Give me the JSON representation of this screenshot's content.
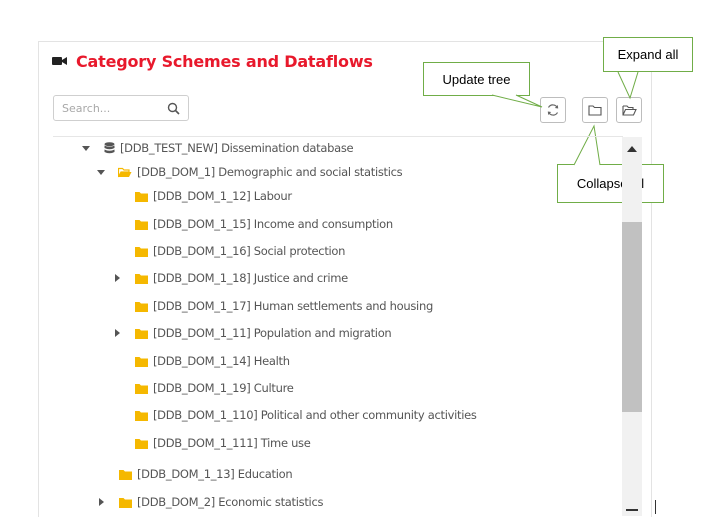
{
  "panel": {
    "title": "Category Schemes and Dataflows",
    "title_color": "#e8192c",
    "title_icon": "video-camera-icon"
  },
  "search": {
    "placeholder": "Search...",
    "icon": "search-icon"
  },
  "toolbar": {
    "update_icon": "refresh-icon",
    "collapse_icon": "folder-icon",
    "expand_icon": "folder-open-icon"
  },
  "callouts": {
    "update_tree": "Update tree",
    "expand_all": "Expand all",
    "collapse_all": "Collapse all",
    "border_color": "#70ad47"
  },
  "tree": [
    {
      "label": "[DDB_TEST_NEW] Dissemination database",
      "icon": "database-icon",
      "expander": "expanded"
    },
    {
      "label": "[DDB_DOM_1] Demographic and social statistics",
      "icon": "folder-open-icon",
      "expander": "expanded"
    },
    {
      "label": "[DDB_DOM_1_12] Labour",
      "icon": "folder-icon",
      "expander": "none"
    },
    {
      "label": "[DDB_DOM_1_15] Income and consumption",
      "icon": "folder-icon",
      "expander": "none"
    },
    {
      "label": "[DDB_DOM_1_16] Social protection",
      "icon": "folder-icon",
      "expander": "none"
    },
    {
      "label": "[DDB_DOM_1_18] Justice and crime",
      "icon": "folder-icon",
      "expander": "collapsed"
    },
    {
      "label": "[DDB_DOM_1_17] Human settlements and housing",
      "icon": "folder-icon",
      "expander": "none"
    },
    {
      "label": "[DDB_DOM_1_11] Population and migration",
      "icon": "folder-icon",
      "expander": "collapsed"
    },
    {
      "label": "[DDB_DOM_1_14] Health",
      "icon": "folder-icon",
      "expander": "none"
    },
    {
      "label": "[DDB_DOM_1_19] Culture",
      "icon": "folder-icon",
      "expander": "none"
    },
    {
      "label": "[DDB_DOM_1_110] Political and other community activities",
      "icon": "folder-icon",
      "expander": "none"
    },
    {
      "label": "[DDB_DOM_1_111] Time use",
      "icon": "folder-icon",
      "expander": "none"
    },
    {
      "label": "[DDB_DOM_1_13] Education",
      "icon": "folder-icon",
      "expander": "none"
    },
    {
      "label": "[DDB_DOM_2] Economic statistics",
      "icon": "folder-icon",
      "expander": "collapsed"
    }
  ],
  "colors": {
    "folder": "#f5b800",
    "database": "#555555",
    "scroll_thumb": "#c1c1c1"
  }
}
